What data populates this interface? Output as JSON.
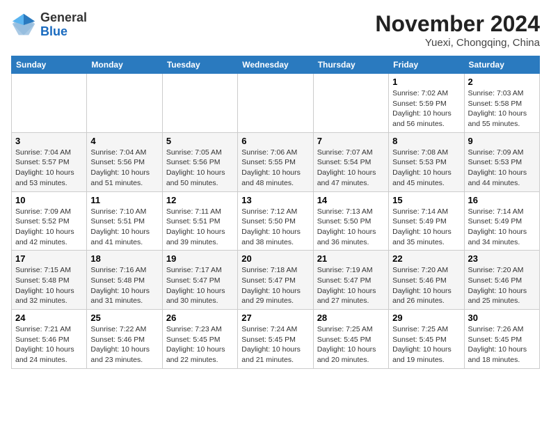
{
  "header": {
    "logo": {
      "general": "General",
      "blue": "Blue"
    },
    "title": "November 2024",
    "location": "Yuexi, Chongqing, China"
  },
  "weekdays": [
    "Sunday",
    "Monday",
    "Tuesday",
    "Wednesday",
    "Thursday",
    "Friday",
    "Saturday"
  ],
  "weeks": [
    [
      {
        "day": "",
        "sunrise": "",
        "sunset": "",
        "daylight": ""
      },
      {
        "day": "",
        "sunrise": "",
        "sunset": "",
        "daylight": ""
      },
      {
        "day": "",
        "sunrise": "",
        "sunset": "",
        "daylight": ""
      },
      {
        "day": "",
        "sunrise": "",
        "sunset": "",
        "daylight": ""
      },
      {
        "day": "",
        "sunrise": "",
        "sunset": "",
        "daylight": ""
      },
      {
        "day": "1",
        "sunrise": "Sunrise: 7:02 AM",
        "sunset": "Sunset: 5:59 PM",
        "daylight": "Daylight: 10 hours and 56 minutes."
      },
      {
        "day": "2",
        "sunrise": "Sunrise: 7:03 AM",
        "sunset": "Sunset: 5:58 PM",
        "daylight": "Daylight: 10 hours and 55 minutes."
      }
    ],
    [
      {
        "day": "3",
        "sunrise": "Sunrise: 7:04 AM",
        "sunset": "Sunset: 5:57 PM",
        "daylight": "Daylight: 10 hours and 53 minutes."
      },
      {
        "day": "4",
        "sunrise": "Sunrise: 7:04 AM",
        "sunset": "Sunset: 5:56 PM",
        "daylight": "Daylight: 10 hours and 51 minutes."
      },
      {
        "day": "5",
        "sunrise": "Sunrise: 7:05 AM",
        "sunset": "Sunset: 5:56 PM",
        "daylight": "Daylight: 10 hours and 50 minutes."
      },
      {
        "day": "6",
        "sunrise": "Sunrise: 7:06 AM",
        "sunset": "Sunset: 5:55 PM",
        "daylight": "Daylight: 10 hours and 48 minutes."
      },
      {
        "day": "7",
        "sunrise": "Sunrise: 7:07 AM",
        "sunset": "Sunset: 5:54 PM",
        "daylight": "Daylight: 10 hours and 47 minutes."
      },
      {
        "day": "8",
        "sunrise": "Sunrise: 7:08 AM",
        "sunset": "Sunset: 5:53 PM",
        "daylight": "Daylight: 10 hours and 45 minutes."
      },
      {
        "day": "9",
        "sunrise": "Sunrise: 7:09 AM",
        "sunset": "Sunset: 5:53 PM",
        "daylight": "Daylight: 10 hours and 44 minutes."
      }
    ],
    [
      {
        "day": "10",
        "sunrise": "Sunrise: 7:09 AM",
        "sunset": "Sunset: 5:52 PM",
        "daylight": "Daylight: 10 hours and 42 minutes."
      },
      {
        "day": "11",
        "sunrise": "Sunrise: 7:10 AM",
        "sunset": "Sunset: 5:51 PM",
        "daylight": "Daylight: 10 hours and 41 minutes."
      },
      {
        "day": "12",
        "sunrise": "Sunrise: 7:11 AM",
        "sunset": "Sunset: 5:51 PM",
        "daylight": "Daylight: 10 hours and 39 minutes."
      },
      {
        "day": "13",
        "sunrise": "Sunrise: 7:12 AM",
        "sunset": "Sunset: 5:50 PM",
        "daylight": "Daylight: 10 hours and 38 minutes."
      },
      {
        "day": "14",
        "sunrise": "Sunrise: 7:13 AM",
        "sunset": "Sunset: 5:50 PM",
        "daylight": "Daylight: 10 hours and 36 minutes."
      },
      {
        "day": "15",
        "sunrise": "Sunrise: 7:14 AM",
        "sunset": "Sunset: 5:49 PM",
        "daylight": "Daylight: 10 hours and 35 minutes."
      },
      {
        "day": "16",
        "sunrise": "Sunrise: 7:14 AM",
        "sunset": "Sunset: 5:49 PM",
        "daylight": "Daylight: 10 hours and 34 minutes."
      }
    ],
    [
      {
        "day": "17",
        "sunrise": "Sunrise: 7:15 AM",
        "sunset": "Sunset: 5:48 PM",
        "daylight": "Daylight: 10 hours and 32 minutes."
      },
      {
        "day": "18",
        "sunrise": "Sunrise: 7:16 AM",
        "sunset": "Sunset: 5:48 PM",
        "daylight": "Daylight: 10 hours and 31 minutes."
      },
      {
        "day": "19",
        "sunrise": "Sunrise: 7:17 AM",
        "sunset": "Sunset: 5:47 PM",
        "daylight": "Daylight: 10 hours and 30 minutes."
      },
      {
        "day": "20",
        "sunrise": "Sunrise: 7:18 AM",
        "sunset": "Sunset: 5:47 PM",
        "daylight": "Daylight: 10 hours and 29 minutes."
      },
      {
        "day": "21",
        "sunrise": "Sunrise: 7:19 AM",
        "sunset": "Sunset: 5:47 PM",
        "daylight": "Daylight: 10 hours and 27 minutes."
      },
      {
        "day": "22",
        "sunrise": "Sunrise: 7:20 AM",
        "sunset": "Sunset: 5:46 PM",
        "daylight": "Daylight: 10 hours and 26 minutes."
      },
      {
        "day": "23",
        "sunrise": "Sunrise: 7:20 AM",
        "sunset": "Sunset: 5:46 PM",
        "daylight": "Daylight: 10 hours and 25 minutes."
      }
    ],
    [
      {
        "day": "24",
        "sunrise": "Sunrise: 7:21 AM",
        "sunset": "Sunset: 5:46 PM",
        "daylight": "Daylight: 10 hours and 24 minutes."
      },
      {
        "day": "25",
        "sunrise": "Sunrise: 7:22 AM",
        "sunset": "Sunset: 5:46 PM",
        "daylight": "Daylight: 10 hours and 23 minutes."
      },
      {
        "day": "26",
        "sunrise": "Sunrise: 7:23 AM",
        "sunset": "Sunset: 5:45 PM",
        "daylight": "Daylight: 10 hours and 22 minutes."
      },
      {
        "day": "27",
        "sunrise": "Sunrise: 7:24 AM",
        "sunset": "Sunset: 5:45 PM",
        "daylight": "Daylight: 10 hours and 21 minutes."
      },
      {
        "day": "28",
        "sunrise": "Sunrise: 7:25 AM",
        "sunset": "Sunset: 5:45 PM",
        "daylight": "Daylight: 10 hours and 20 minutes."
      },
      {
        "day": "29",
        "sunrise": "Sunrise: 7:25 AM",
        "sunset": "Sunset: 5:45 PM",
        "daylight": "Daylight: 10 hours and 19 minutes."
      },
      {
        "day": "30",
        "sunrise": "Sunrise: 7:26 AM",
        "sunset": "Sunset: 5:45 PM",
        "daylight": "Daylight: 10 hours and 18 minutes."
      }
    ]
  ]
}
